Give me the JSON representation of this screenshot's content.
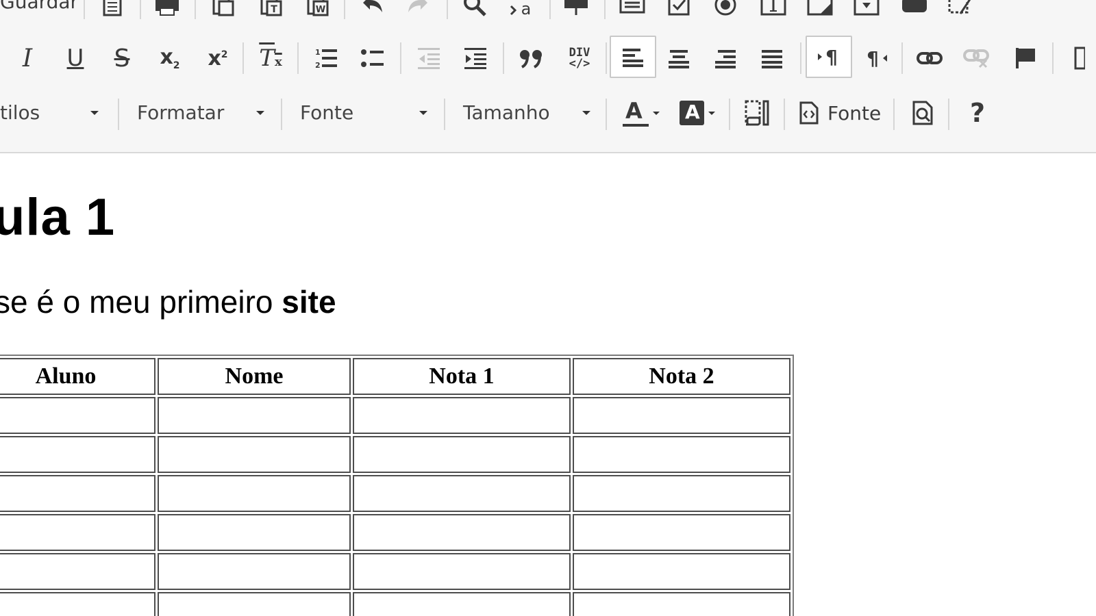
{
  "toolbar": {
    "row1": {
      "save_label": "Guardar",
      "icons": [
        "new-page-icon",
        "print-icon",
        "paste-icon",
        "paste-text-icon",
        "paste-word-icon",
        "undo-icon",
        "redo-icon",
        "find-icon",
        "replace-icon",
        "form-icon",
        "text-field-icon",
        "checkbox-icon",
        "radio-icon",
        "textarea-icon",
        "textarea-resize-icon",
        "select-icon",
        "button-icon",
        "image-button-icon"
      ]
    },
    "row2": {
      "italic": "I",
      "underline": "U",
      "strike": "S",
      "subscript": "x",
      "subscript_small": "2",
      "superscript": "x",
      "superscript_small": "2",
      "remove_format": "T",
      "remove_format_x": "x",
      "blockquote": "❞",
      "div_top": "DIV",
      "div_bottom": "</>"
    },
    "row3": {
      "styles_label": "tilos",
      "format_label": "Formatar",
      "font_label": "Fonte",
      "size_label": "Tamanho",
      "text_color_glyph": "A",
      "bg_color_glyph": "A",
      "source_label": "Fonte",
      "help_glyph": "?"
    }
  },
  "document": {
    "heading": "ula 1",
    "paragraph_plain": "se é o meu primeiro ",
    "paragraph_bold": "site",
    "table": {
      "headers": [
        "Aluno",
        "Nome",
        "Nota 1",
        "Nota 2"
      ],
      "rows": [
        [
          "",
          "",
          "",
          ""
        ],
        [
          "",
          "",
          "",
          ""
        ],
        [
          "",
          "",
          "",
          ""
        ],
        [
          "",
          "",
          "",
          ""
        ],
        [
          "",
          "",
          "",
          ""
        ],
        [
          "",
          "",
          "",
          ""
        ]
      ]
    }
  }
}
